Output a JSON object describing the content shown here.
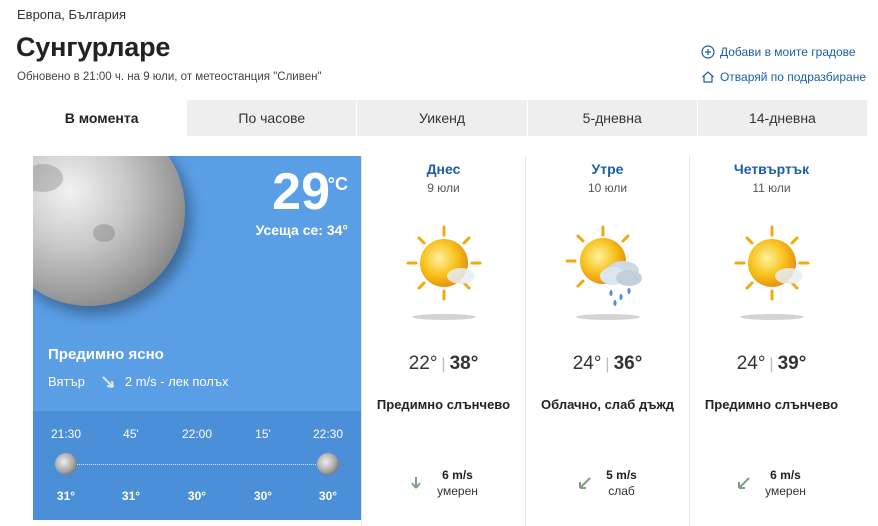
{
  "breadcrumb": "Европа, България",
  "title": "Сунгурларе",
  "updated": "Обновено в 21:00 ч. на 9 юли, от метеостанция \"Сливен\"",
  "actions": {
    "add_city": "Добави в моите градове",
    "open_default": "Отваряй по подразбиране"
  },
  "tabs": [
    "В момента",
    "По часове",
    "Уикенд",
    "5-дневна",
    "14-дневна"
  ],
  "now": {
    "temperature": "29",
    "unit": "°C",
    "feels_label": "Усеща се:",
    "feels_value": "34°",
    "condition": "Предимно ясно",
    "wind_label": "Вятър",
    "wind_value": "2 m/s - лек полъх",
    "icon": "moon-icon",
    "hourly": {
      "times": [
        "21:30",
        "45'",
        "22:00",
        "15'",
        "22:30"
      ],
      "temps": [
        "31°",
        "31°",
        "30°",
        "30°",
        "30°"
      ]
    }
  },
  "days": [
    {
      "name": "Днес",
      "date": "9 юли",
      "min": "22°",
      "max": "38°",
      "condition": "Предимно слънчево",
      "icon": "sun-partly-cloudy-icon",
      "wind_speed": "6 m/s",
      "wind_desc": "умерен"
    },
    {
      "name": "Утре",
      "date": "10 юли",
      "min": "24°",
      "max": "36°",
      "condition": "Облачно, слаб дъжд",
      "icon": "sun-cloud-rain-icon",
      "wind_speed": "5 m/s",
      "wind_desc": "слаб"
    },
    {
      "name": "Четвъртък",
      "date": "11 юли",
      "min": "24°",
      "max": "39°",
      "condition": "Предимно слънчево",
      "icon": "sun-partly-cloudy-icon",
      "wind_speed": "6 m/s",
      "wind_desc": "умерен"
    }
  ],
  "colors": {
    "accent": "#1a5fa8",
    "now_card": "#5a9fe6",
    "hourly_strip": "#4a8fd8",
    "sun": "#f6b21a"
  }
}
